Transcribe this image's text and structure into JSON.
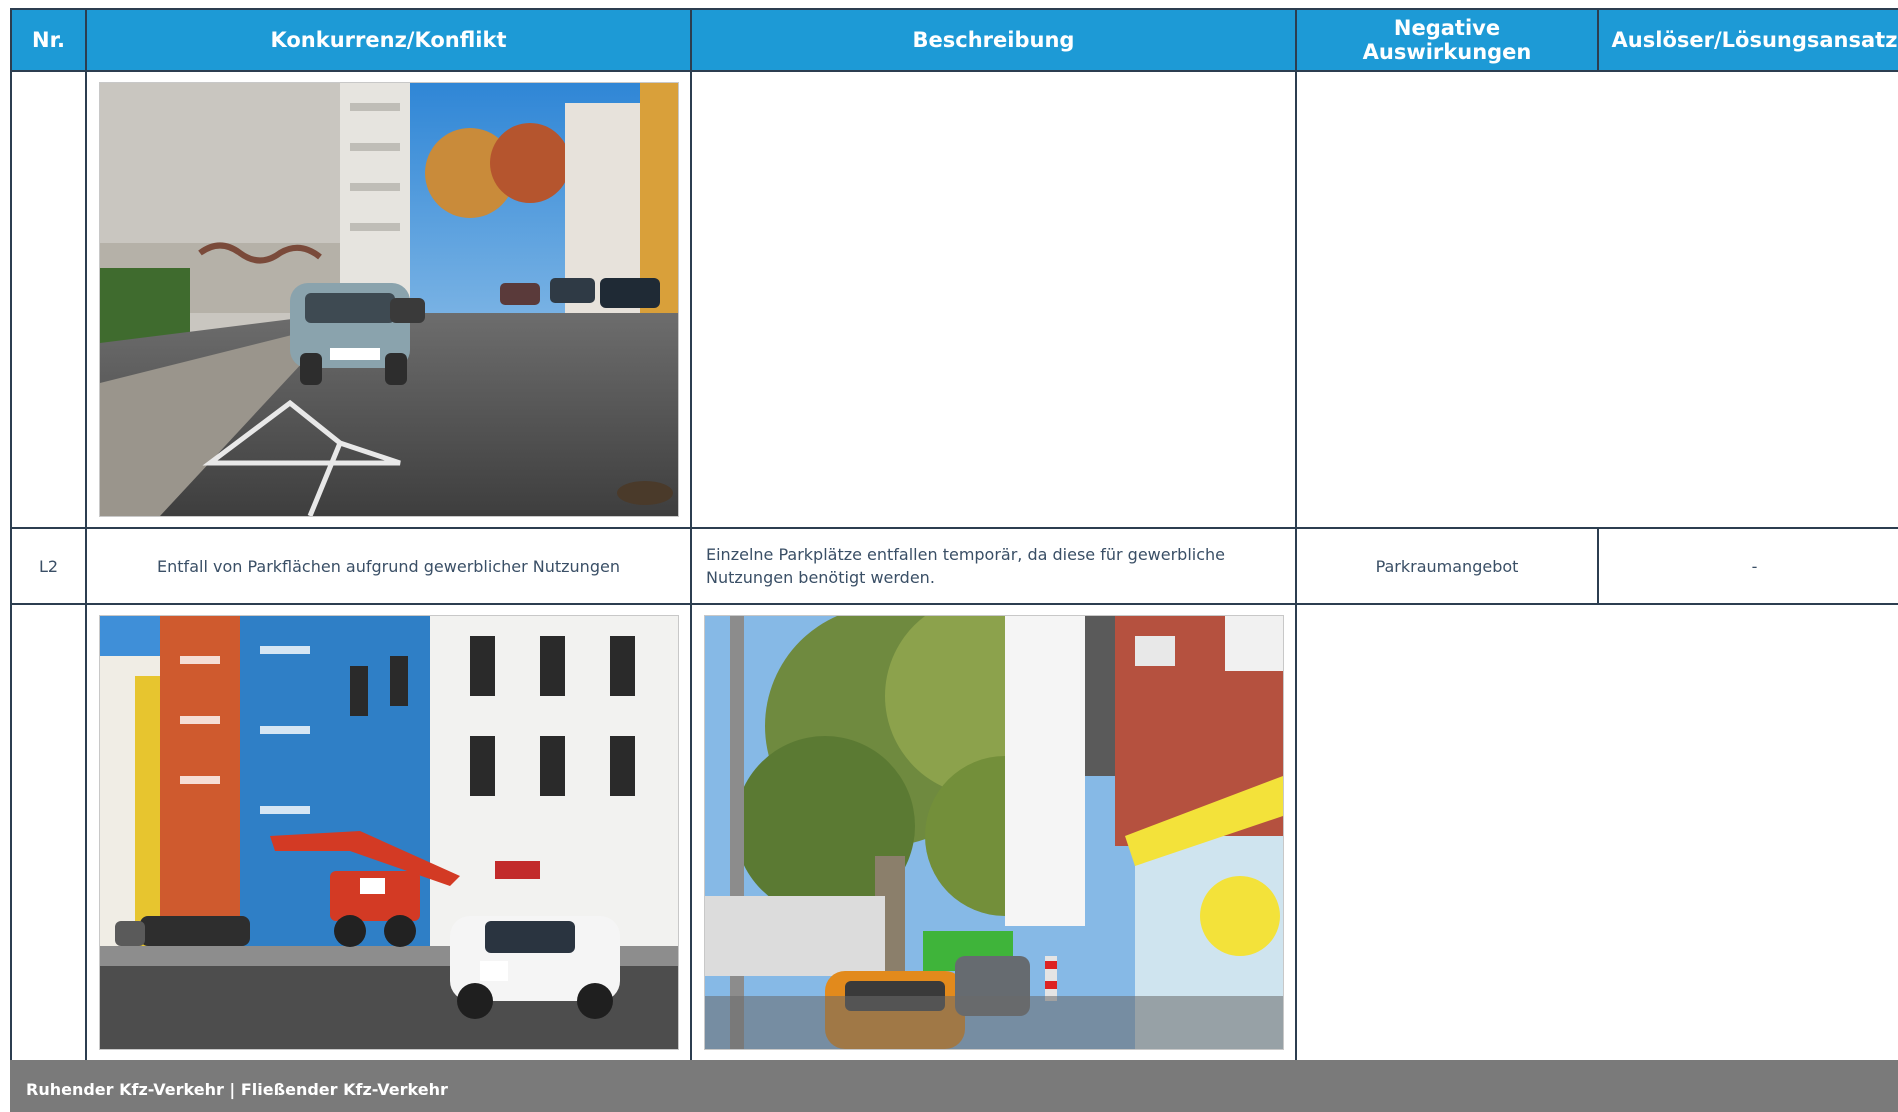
{
  "table": {
    "headers": {
      "nr": "Nr.",
      "konflikt": "Konkurrenz/Konflikt",
      "beschreibung": "Beschreibung",
      "negative_line1": "Negative",
      "negative_line2": "Auswirkungen",
      "ausloeser": "Auslöser/Lösungsansatz"
    },
    "row_l2": {
      "nr": "L2",
      "konflikt": "Entfall von Parkflächen aufgrund gewerblicher Nutzungen",
      "beschreibung": "Einzelne Parkplätze entfallen temporär, da diese für gewerbliche Nutzungen benötigt werden.",
      "negative": "Parkraumangebot",
      "ausloeser": "-"
    }
  },
  "footer": {
    "label": "Ruhender Kfz-Verkehr | Fließender Kfz-Verkehr"
  },
  "colors": {
    "header_bg": "#1d9ad6",
    "header_text": "#ffffff",
    "border": "#2c3e50",
    "body_text": "#3a4f66",
    "footer_bg": "#7a7a7a"
  }
}
